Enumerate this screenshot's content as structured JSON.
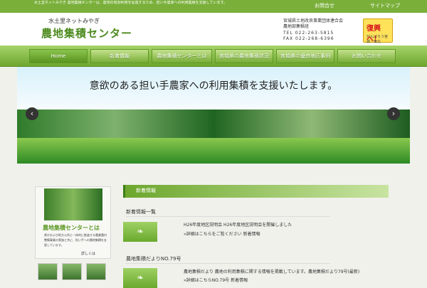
{
  "topbar": {
    "description": "水土里ネットみやぎ 農地集積センターは、農地の有効利用を促進するため、担い手農家への利用集積を支援しています。",
    "links": [
      "お問合せ",
      "サイトマップ"
    ]
  },
  "header": {
    "tagline": "水土里ネットみやぎ",
    "title": "農地集積センター",
    "organization": "宮城県土地改良事業団体連合会",
    "department": "農地部集積班",
    "tel": "TEL 022-263-5815",
    "fax": "FAX 022-268-6396",
    "banner_title": "復興へ！",
    "banner_sub": "がんばろう宮城・東北"
  },
  "nav": [
    "Home",
    "新着情報",
    "農地集積センターとは",
    "宮城県の農地集積状況",
    "宮城県の優良地区事例",
    "お問い合わせ"
  ],
  "hero": {
    "title": "意欲のある担い手農家への利用集積を支援いたします。"
  },
  "sidebar": {
    "title": "農地集積センターとは",
    "description": "県庁および地方公所と一体的に推進する農業農村整備事業の実施と共に、担い手への農地集積を支援しています。",
    "more": "詳しくは"
  },
  "content": {
    "section_title": "新着情報",
    "item1_title": "新着情報一覧",
    "item1_text1": "H26年度地区説明会 H26年度地区説明会を開催しました",
    "item1_text2": "»詳細はこちらをご覧ください 新着情報",
    "item2_title": "農地集積だよりNO.79号",
    "item2_text1": "農地集積だより 農地の利用集積に関する情報を掲載しています。農地集積だより79号(最新)",
    "item2_text2": "»詳細はこちらNO.79号 新着情報"
  }
}
